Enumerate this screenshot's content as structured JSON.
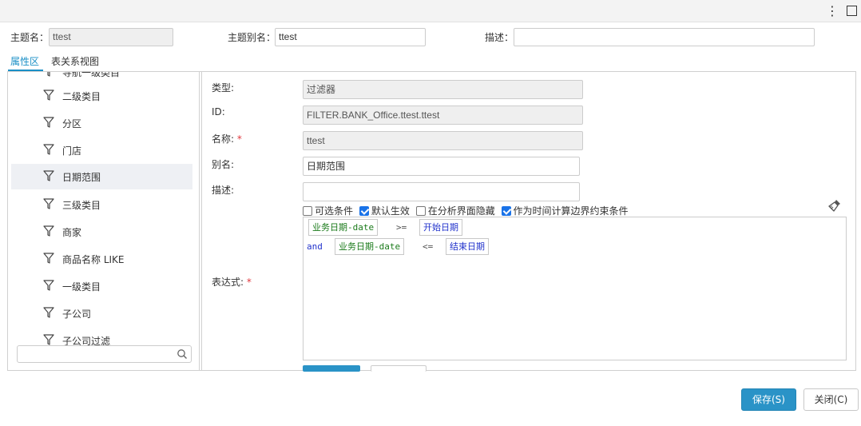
{
  "window": {
    "more_icon": "more-vert-icon",
    "maximize_icon": "maximize-icon"
  },
  "header": {
    "topic_name_label": "主题名：",
    "topic_name_value": "ttest",
    "topic_alias_label": "主题别名：",
    "topic_alias_value": "ttest",
    "description_label": "描述：",
    "description_value": ""
  },
  "tabs": [
    {
      "label": "属性区",
      "active": true
    },
    {
      "label": "表关系视图",
      "active": false
    }
  ],
  "tree": {
    "items": [
      {
        "label": "导航一级类目",
        "selected": false
      },
      {
        "label": "二级类目",
        "selected": false
      },
      {
        "label": "分区",
        "selected": false
      },
      {
        "label": "门店",
        "selected": false
      },
      {
        "label": "日期范围",
        "selected": true
      },
      {
        "label": "三级类目",
        "selected": false
      },
      {
        "label": "商家",
        "selected": false
      },
      {
        "label": "商品名称 LIKE",
        "selected": false
      },
      {
        "label": "一级类目",
        "selected": false
      },
      {
        "label": "子公司",
        "selected": false
      },
      {
        "label": "子公司过滤",
        "selected": false
      }
    ],
    "search_placeholder": "",
    "search_icon": "search-icon"
  },
  "form": {
    "type_label": "类型:",
    "type_value": "过滤器",
    "id_label": "ID:",
    "id_value": "FILTER.BANK_Office.ttest.ttest",
    "name_label": "名称:",
    "name_value": "ttest",
    "alias_label": "别名:",
    "alias_value": "日期范围",
    "desc_label": "描述:",
    "desc_value": "",
    "expr_label": "表达式:",
    "required_mark": "*",
    "checkboxes": [
      {
        "label": "可选条件",
        "checked": false
      },
      {
        "label": "默认生效",
        "checked": true
      },
      {
        "label": "在分析界面隐藏",
        "checked": false
      },
      {
        "label": "作为时间计算边界约束条件",
        "checked": true
      }
    ],
    "clear_icon": "brush-icon",
    "expression": {
      "line1": {
        "field": "业务日期-date",
        "op": ">=",
        "param": "开始日期"
      },
      "line2": {
        "keyword": "and",
        "field": "业务日期-date",
        "op": "<=",
        "param": "结束日期"
      }
    }
  },
  "footer": {
    "save_label": "保存(S)",
    "close_label": "关闭(C)"
  },
  "colors": {
    "accent": "#1a8fc6",
    "primary_button": "#2a93c7",
    "field_token": "#1a7a1a",
    "param_token": "#2233cc",
    "required": "#e0383e"
  }
}
